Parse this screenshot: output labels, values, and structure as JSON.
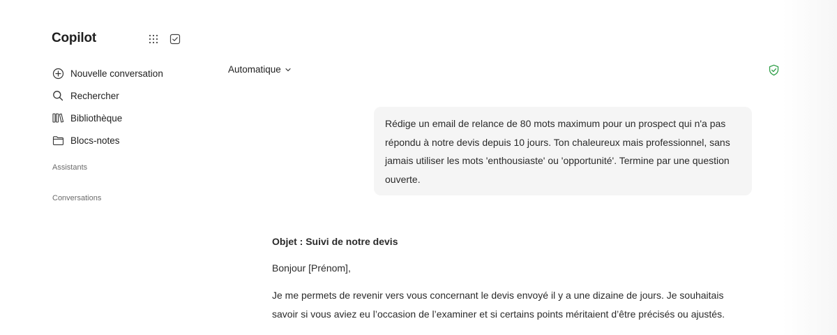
{
  "app": {
    "title": "Copilot"
  },
  "header_icons": [
    {
      "name": "apps-grid-icon"
    },
    {
      "name": "tasks-check-icon"
    }
  ],
  "sidebar": {
    "items": [
      {
        "label": "Nouvelle conversation",
        "icon": "plus-circle-icon"
      },
      {
        "label": "Rechercher",
        "icon": "search-icon"
      },
      {
        "label": "Bibliothèque",
        "icon": "library-icon"
      },
      {
        "label": "Blocs-notes",
        "icon": "folder-icon"
      }
    ],
    "sections": {
      "assistants": "Assistants",
      "conversations": "Conversations"
    }
  },
  "main": {
    "model_selector": "Automatique",
    "shield_icon": "shield-check-icon",
    "shield_color": "#2e9e47",
    "user_message": "Rédige un email de relance de 80 mots maximum pour un prospect qui n'a pas répondu à notre devis depuis 10 jours. Ton chaleureux mais professionnel, sans jamais utiliser les mots 'enthousiaste' ou 'opportunité'. Termine par une question ouverte.",
    "reply": {
      "subject": "Objet : Suivi de notre devis",
      "greeting": "Bonjour [Prénom],",
      "paragraph": "Je me permets de revenir vers vous concernant le devis envoyé il y a une dizaine de jours. Je souhaitais savoir si vous aviez eu l’occasion de l’examiner et si certains points méritaient d’être précisés ou ajustés."
    }
  }
}
